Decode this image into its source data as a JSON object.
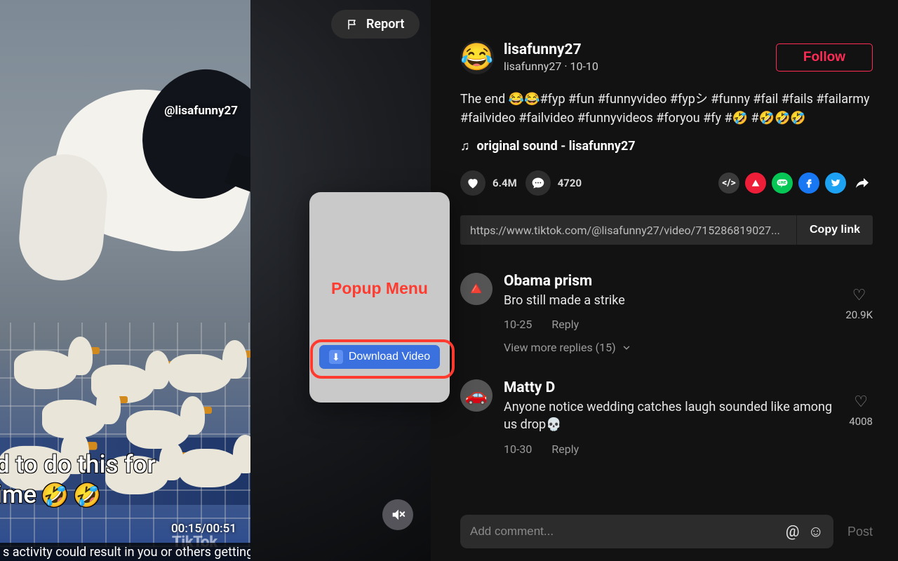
{
  "video": {
    "watermark": "@lisafunny27",
    "caption_line1": "d to do this for",
    "caption_line2": "ime",
    "time_current": "00:15",
    "time_total": "00:51",
    "tiktok_logo": "TikTok",
    "warning": "s activity could result in you or others getting hurt."
  },
  "report": {
    "label": "Report"
  },
  "popup": {
    "title": "Popup Menu",
    "download_label": "Download Video"
  },
  "profile": {
    "avatar_emoji": "😂",
    "username": "lisafunny27",
    "subline": "lisafunny27 · 10-10",
    "follow_label": "Follow"
  },
  "description": "The end 😂😂#fyp #fun #funnyvideo #fypシ #funny #fail #fails #failarmy #failvideo #failvideo #funnyvideos #foryou #fy #🤣 #🤣🤣🤣",
  "sound": {
    "icon": "♫",
    "label": "original sound - lisafunny27"
  },
  "stats": {
    "likes": "6.4M",
    "comments": "4720"
  },
  "share": {
    "embed": "</>",
    "link_url": "https://www.tiktok.com/@lisafunny27/video/715286819027...",
    "copy_label": "Copy link"
  },
  "comments": [
    {
      "avatar_emoji": "🔺",
      "name": "Obama prism",
      "text": "Bro still made a strike",
      "date": "10-25",
      "reply_label": "Reply",
      "likes": "20.9K",
      "more_replies": "View more replies (15)"
    },
    {
      "avatar_emoji": "🚗",
      "name": "Matty D",
      "text": "Anyone notice wedding catches laugh sounded like among us drop💀",
      "date": "10-30",
      "reply_label": "Reply",
      "likes": "4008"
    }
  ],
  "composer": {
    "placeholder": "Add comment...",
    "post_label": "Post"
  }
}
